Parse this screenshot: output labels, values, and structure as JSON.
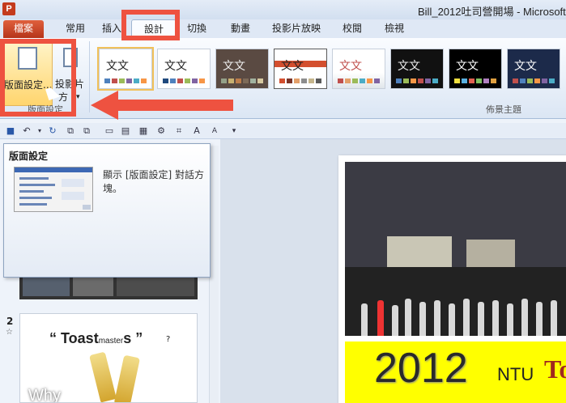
{
  "window": {
    "title": "Bill_2012吐司營開場 - Microsoft",
    "app_icon": "P"
  },
  "tabs": [
    {
      "label": "檔案",
      "kind": "file"
    },
    {
      "label": "常用"
    },
    {
      "label": "插入"
    },
    {
      "label": "設計",
      "active": true
    },
    {
      "label": "切換"
    },
    {
      "label": "動畫"
    },
    {
      "label": "投影片放映"
    },
    {
      "label": "校閱"
    },
    {
      "label": "檢視"
    }
  ],
  "ribbon": {
    "page_setup_label": "版面設定...",
    "orientation_line1": "投影片",
    "orientation_line2": "方",
    "orientation_arrow": "▾",
    "group_page_setup": "版面設定",
    "group_themes": "佈景主題",
    "theme_sample_text": "文文"
  },
  "tooltip": {
    "title": "版面設定",
    "description": "顯示 [版面設定] 對話方塊。"
  },
  "slides": {
    "slide2_number": "2",
    "slide2_star": "☆",
    "toast_prefix": "“ ",
    "toast_word1": "Toast",
    "toast_word2": "master",
    "toast_word3": "s",
    "toast_suffix": " ”",
    "toast_q": "?",
    "why": "Why"
  },
  "main_slide": {
    "year": "2012",
    "ntu": "NTU",
    "to": "To"
  },
  "colors": {
    "file_tab": "#c63d1c",
    "highlight_red": "#ee5240",
    "selected_button": "#ffd56e"
  }
}
